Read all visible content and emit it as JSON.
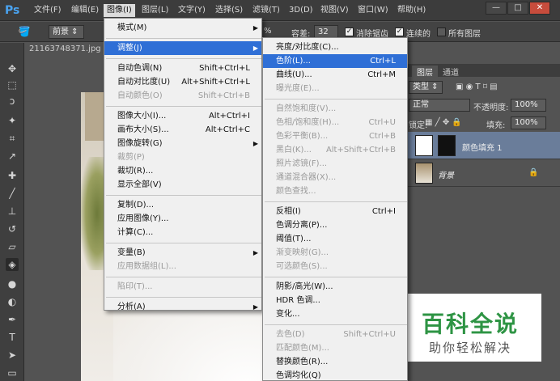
{
  "menubar": {
    "logo": "Ps",
    "items": [
      "文件(F)",
      "编辑(E)",
      "图像(I)",
      "图层(L)",
      "文字(Y)",
      "选择(S)",
      "滤镜(T)",
      "3D(D)",
      "视图(V)",
      "窗口(W)",
      "帮助(H)"
    ],
    "window_buttons": [
      "—",
      "□",
      "✕"
    ]
  },
  "options": {
    "mode_label": "前景",
    "percent": "%",
    "tolerance_label": "容差:",
    "tolerance_value": "32",
    "antialias_label": "消除锯齿",
    "contiguous_label": "连续的",
    "all_layers_label": "所有图层"
  },
  "document": {
    "tab_title": "21163748371.jpg"
  },
  "image_menu": {
    "items": [
      {
        "label": "模式(M)",
        "shortcut": "",
        "submenu": true,
        "disabled": false,
        "highlight": false
      },
      {
        "sep": true
      },
      {
        "label": "调整(J)",
        "shortcut": "",
        "submenu": true,
        "disabled": false,
        "highlight": true
      },
      {
        "sep": true
      },
      {
        "label": "自动色调(N)",
        "shortcut": "Shift+Ctrl+L",
        "submenu": false,
        "disabled": false,
        "highlight": false
      },
      {
        "label": "自动对比度(U)",
        "shortcut": "Alt+Shift+Ctrl+L",
        "submenu": false,
        "disabled": false,
        "highlight": false
      },
      {
        "label": "自动颜色(O)",
        "shortcut": "Shift+Ctrl+B",
        "submenu": false,
        "disabled": true,
        "highlight": false
      },
      {
        "sep": true
      },
      {
        "label": "图像大小(I)...",
        "shortcut": "Alt+Ctrl+I",
        "submenu": false,
        "disabled": false,
        "highlight": false
      },
      {
        "label": "画布大小(S)...",
        "shortcut": "Alt+Ctrl+C",
        "submenu": false,
        "disabled": false,
        "highlight": false
      },
      {
        "label": "图像旋转(G)",
        "shortcut": "",
        "submenu": true,
        "disabled": false,
        "highlight": false
      },
      {
        "label": "裁剪(P)",
        "shortcut": "",
        "submenu": false,
        "disabled": true,
        "highlight": false
      },
      {
        "label": "裁切(R)...",
        "shortcut": "",
        "submenu": false,
        "disabled": false,
        "highlight": false
      },
      {
        "label": "显示全部(V)",
        "shortcut": "",
        "submenu": false,
        "disabled": false,
        "highlight": false
      },
      {
        "sep": true
      },
      {
        "label": "复制(D)...",
        "shortcut": "",
        "submenu": false,
        "disabled": false,
        "highlight": false
      },
      {
        "label": "应用图像(Y)...",
        "shortcut": "",
        "submenu": false,
        "disabled": false,
        "highlight": false
      },
      {
        "label": "计算(C)...",
        "shortcut": "",
        "submenu": false,
        "disabled": false,
        "highlight": false
      },
      {
        "sep": true
      },
      {
        "label": "变量(B)",
        "shortcut": "",
        "submenu": true,
        "disabled": false,
        "highlight": false
      },
      {
        "label": "应用数据组(L)...",
        "shortcut": "",
        "submenu": false,
        "disabled": true,
        "highlight": false
      },
      {
        "sep": true
      },
      {
        "label": "陷印(T)...",
        "shortcut": "",
        "submenu": false,
        "disabled": true,
        "highlight": false
      },
      {
        "sep": true
      },
      {
        "label": "分析(A)",
        "shortcut": "",
        "submenu": true,
        "disabled": false,
        "highlight": false
      }
    ]
  },
  "adjust_menu": {
    "items": [
      {
        "label": "亮度/对比度(C)...",
        "shortcut": "",
        "disabled": false,
        "highlight": false
      },
      {
        "label": "色阶(L)...",
        "shortcut": "Ctrl+L",
        "disabled": false,
        "highlight": true
      },
      {
        "label": "曲线(U)...",
        "shortcut": "Ctrl+M",
        "disabled": false,
        "highlight": false
      },
      {
        "label": "曝光度(E)...",
        "shortcut": "",
        "disabled": true,
        "highlight": false
      },
      {
        "sep": true
      },
      {
        "label": "自然饱和度(V)...",
        "shortcut": "",
        "disabled": true,
        "highlight": false
      },
      {
        "label": "色相/饱和度(H)...",
        "shortcut": "Ctrl+U",
        "disabled": true,
        "highlight": false
      },
      {
        "label": "色彩平衡(B)...",
        "shortcut": "Ctrl+B",
        "disabled": true,
        "highlight": false
      },
      {
        "label": "黑白(K)...",
        "shortcut": "Alt+Shift+Ctrl+B",
        "disabled": true,
        "highlight": false
      },
      {
        "label": "照片滤镜(F)...",
        "shortcut": "",
        "disabled": true,
        "highlight": false
      },
      {
        "label": "通道混合器(X)...",
        "shortcut": "",
        "disabled": true,
        "highlight": false
      },
      {
        "label": "颜色查找...",
        "shortcut": "",
        "disabled": true,
        "highlight": false
      },
      {
        "sep": true
      },
      {
        "label": "反相(I)",
        "shortcut": "Ctrl+I",
        "disabled": false,
        "highlight": false
      },
      {
        "label": "色调分离(P)...",
        "shortcut": "",
        "disabled": false,
        "highlight": false
      },
      {
        "label": "阈值(T)...",
        "shortcut": "",
        "disabled": false,
        "highlight": false
      },
      {
        "label": "渐变映射(G)...",
        "shortcut": "",
        "disabled": true,
        "highlight": false
      },
      {
        "label": "可选颜色(S)...",
        "shortcut": "",
        "disabled": true,
        "highlight": false
      },
      {
        "sep": true
      },
      {
        "label": "阴影/高光(W)...",
        "shortcut": "",
        "disabled": false,
        "highlight": false
      },
      {
        "label": "HDR 色调...",
        "shortcut": "",
        "disabled": false,
        "highlight": false
      },
      {
        "label": "变化...",
        "shortcut": "",
        "disabled": false,
        "highlight": false
      },
      {
        "sep": true
      },
      {
        "label": "去色(D)",
        "shortcut": "Shift+Ctrl+U",
        "disabled": true,
        "highlight": false
      },
      {
        "label": "匹配颜色(M)...",
        "shortcut": "",
        "disabled": true,
        "highlight": false
      },
      {
        "label": "替换颜色(R)...",
        "shortcut": "",
        "disabled": false,
        "highlight": false
      },
      {
        "label": "色调均化(Q)",
        "shortcut": "",
        "disabled": false,
        "highlight": false
      }
    ]
  },
  "layers_panel": {
    "tabs": [
      "图层",
      "通道"
    ],
    "kind_label": "类型",
    "blend_mode": "正常",
    "opacity_label": "不透明度:",
    "opacity_value": "100%",
    "lock_label": "锁定:",
    "fill_label": "填充:",
    "fill_value": "100%",
    "layers": [
      {
        "name": "颜色填充 1",
        "selected": true
      },
      {
        "name": "背景",
        "selected": false
      }
    ]
  },
  "watermark": {
    "title": "百科全说",
    "subtitle": "助你轻松解决"
  },
  "colors": {
    "highlight": "#2f6fd6",
    "menubar": "#3c3c3c",
    "panel": "#535353",
    "watermark_green": "#2e9444"
  }
}
